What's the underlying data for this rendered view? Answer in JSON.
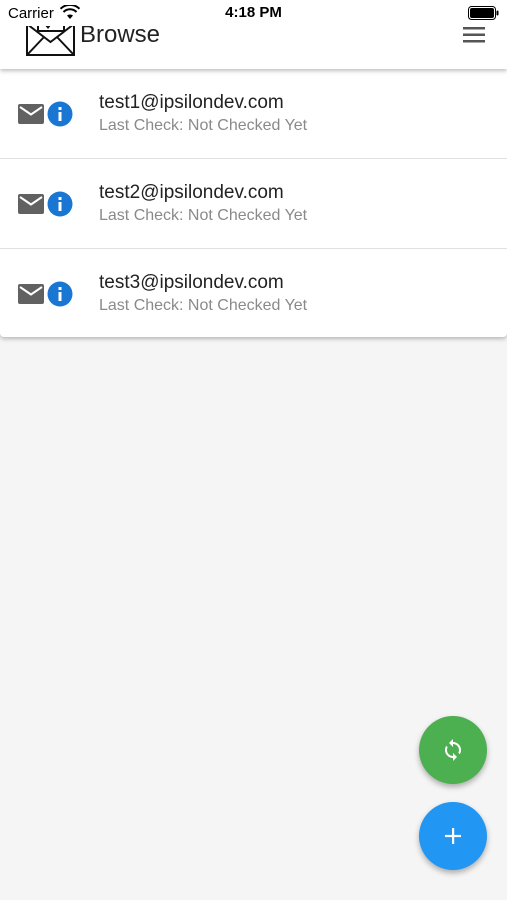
{
  "status_bar": {
    "carrier": "Carrier",
    "time": "4:18 PM"
  },
  "app_bar": {
    "title": "Browse",
    "logo_icon": "envelope-check-icon",
    "menu_icon": "hamburger-menu-icon"
  },
  "accounts": [
    {
      "email": "test1@ipsilondev.com",
      "status": "Last Check: Not Checked Yet"
    },
    {
      "email": "test2@ipsilondev.com",
      "status": "Last Check: Not Checked Yet"
    },
    {
      "email": "test3@ipsilondev.com",
      "status": "Last Check: Not Checked Yet"
    }
  ],
  "fabs": {
    "sync": {
      "icon": "sync-icon",
      "color": "#4caf50"
    },
    "add": {
      "icon": "plus-icon",
      "color": "#2196f3"
    }
  },
  "colors": {
    "info_blue": "#1976d2",
    "mail_gray": "#616161"
  }
}
